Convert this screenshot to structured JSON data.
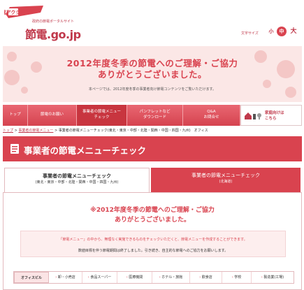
{
  "header": {
    "badge_text": "節電アクション",
    "tagline": "政府の節電ポータルサイト",
    "site_title": "節電.go.jp",
    "font_size_label": "文字サイズ",
    "font_sizes": [
      "小",
      "中",
      "大"
    ]
  },
  "banner": {
    "line1": "2012年度冬季の節電へのご理解・ご協力",
    "line2": "ありがとうございました。",
    "note": "本ページでは、2012年度冬季の事業者向け節電コンテンツをご覧いただけます。"
  },
  "nav": {
    "items": [
      {
        "label": "トップ"
      },
      {
        "label": "節電のお願い"
      },
      {
        "label": "事業者の節電メニュー\nチェック"
      },
      {
        "label": "パンフレットなど\nダウンロード"
      },
      {
        "label": "Q&A\nお問合せ"
      }
    ],
    "home_label": "家庭向けは\nこちら"
  },
  "breadcrumb": {
    "home": "トップ",
    "parent": "事業者の節電メニュー",
    "current": "事業者の節電メニューチェック(東北・東京・中部・北陸・関西・中国・四国・九州)　オフィス"
  },
  "page_title": "事業者の節電メニューチェック",
  "tabs": {
    "active_title": "事業者の節電メニューチェック",
    "active_sub": "(東北・東京・中部・北陸・関西・中国・四国・九州)",
    "inactive_title": "事業者の節電メニューチェック",
    "inactive_sub": "(北海道)"
  },
  "notice": {
    "line1": "※2012年度冬季の節電へのご理解・ご協力",
    "line2": "ありがとうございました。"
  },
  "info": {
    "line1": "「節電メニュー」の中から、無理なく実施できるものをチェックいただくと、節電メニューを作成することができます。",
    "line2": "数値目標を伴う節電期間は終了しました。引き続き、自主的な節電へのご協力をお願いします。"
  },
  "categories": [
    {
      "label": "オフィスビル"
    },
    {
      "label": "卸・小売店"
    },
    {
      "label": "食品スーパー"
    },
    {
      "label": "医療機関"
    },
    {
      "label": "ホテル・旅館"
    },
    {
      "label": "飲食店"
    },
    {
      "label": "学校"
    },
    {
      "label": "製造業(工場)"
    }
  ],
  "colors": {
    "brand": "#d9434f",
    "banner_bg": "#fbe7e6"
  }
}
